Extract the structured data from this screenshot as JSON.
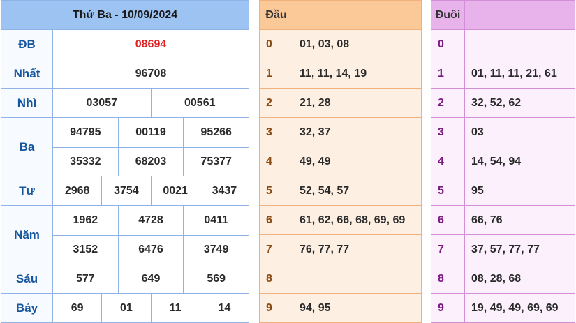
{
  "results": {
    "title": "Thứ Ba - 10/09/2024",
    "special": "08694",
    "labels": {
      "db": "ĐB",
      "nhat": "Nhất",
      "nhi": "Nhì",
      "ba": "Ba",
      "tu": "Tư",
      "nam": "Năm",
      "sau": "Sáu",
      "bay": "Bảy"
    },
    "nhat": [
      "96708"
    ],
    "nhi": [
      "03057",
      "00561"
    ],
    "ba": [
      "94795",
      "00119",
      "95266",
      "35332",
      "68203",
      "75377"
    ],
    "tu": [
      "2968",
      "3754",
      "0021",
      "3437"
    ],
    "nam": [
      "1962",
      "4728",
      "0411",
      "3152",
      "6476",
      "3749"
    ],
    "sau": [
      "577",
      "649",
      "569"
    ],
    "bay": [
      "69",
      "01",
      "11",
      "14"
    ]
  },
  "head": {
    "title": "Đầu",
    "rows": [
      {
        "key": "0",
        "val": "01, 03, 08"
      },
      {
        "key": "1",
        "val": "11, 11, 14, 19"
      },
      {
        "key": "2",
        "val": "21, 28"
      },
      {
        "key": "3",
        "val": "32, 37"
      },
      {
        "key": "4",
        "val": "49, 49"
      },
      {
        "key": "5",
        "val": "52, 54, 57"
      },
      {
        "key": "6",
        "val": "61, 62, 66, 68, 69, 69"
      },
      {
        "key": "7",
        "val": "76, 77, 77"
      },
      {
        "key": "8",
        "val": ""
      },
      {
        "key": "9",
        "val": "94, 95"
      }
    ]
  },
  "tail": {
    "title": "Đuôi",
    "rows": [
      {
        "key": "0",
        "val": ""
      },
      {
        "key": "1",
        "val": "01, 11, 11, 21, 61"
      },
      {
        "key": "2",
        "val": "32, 52, 62"
      },
      {
        "key": "3",
        "val": "03"
      },
      {
        "key": "4",
        "val": "14, 54, 94"
      },
      {
        "key": "5",
        "val": "95"
      },
      {
        "key": "6",
        "val": "66, 76"
      },
      {
        "key": "7",
        "val": "37, 57, 77, 77"
      },
      {
        "key": "8",
        "val": "08, 28, 68"
      },
      {
        "key": "9",
        "val": "19, 49, 49, 69, 69"
      }
    ]
  },
  "colors": {
    "special_number": "#e02020",
    "label_text": "#15569e",
    "results_header_bg": "#9cc3f2",
    "head_header_bg": "#fbc898",
    "tail_header_bg": "#e8b3ea"
  }
}
